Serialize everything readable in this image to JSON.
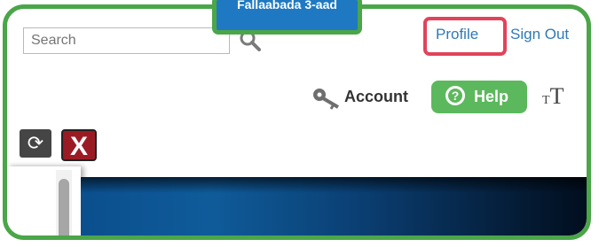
{
  "header": {
    "search": {
      "placeholder": "Search"
    },
    "links": {
      "profile": "Profile",
      "sign_out": "Sign Out"
    }
  },
  "toolbar": {
    "account_label": "Account",
    "help_label": "Help",
    "help_icon_glyph": "?",
    "font_size_icon": {
      "small": "T",
      "big": "T"
    }
  },
  "panel_controls": {
    "refresh_glyph": "⟳",
    "close_glyph": "X"
  },
  "tooltip": {
    "text": "Fallaabada 3-aad"
  },
  "colors": {
    "frame_green": "#4aa648",
    "link_blue": "#2f79b6",
    "highlight_red": "#e2435a",
    "help_green": "#5cb85c",
    "close_red": "#9b1b24",
    "tooltip_blue": "#1f79c2",
    "banner_blue": "#0f5b9a"
  }
}
